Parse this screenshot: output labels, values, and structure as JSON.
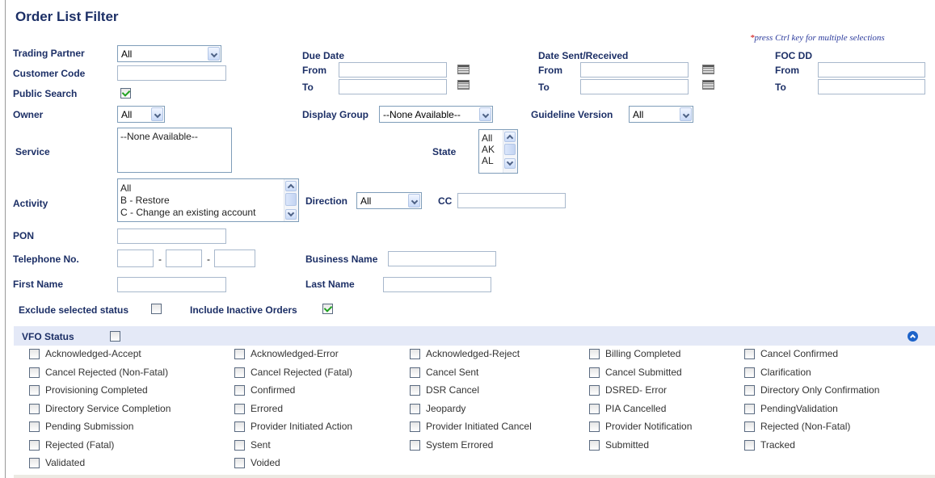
{
  "title": "Order List Filter",
  "note": {
    "star": "*",
    "text": "press Ctrl key for multiple selections"
  },
  "trading_partner": {
    "label": "Trading Partner",
    "value": "All"
  },
  "customer_code": {
    "label": "Customer Code",
    "value": ""
  },
  "public_search": {
    "label": "Public Search",
    "checked": true
  },
  "owner": {
    "label": "Owner",
    "value": "All"
  },
  "due_date": {
    "label": "Due Date",
    "from_label": "From",
    "to_label": "To",
    "from": "",
    "to": ""
  },
  "date_sent": {
    "label": "Date Sent/Received",
    "from_label": "From",
    "to_label": "To",
    "from": "",
    "to": ""
  },
  "foc_dd": {
    "label": "FOC DD",
    "from_label": "From",
    "to_label": "To",
    "from": "",
    "to": ""
  },
  "display_group": {
    "label": "Display Group",
    "value": "--None Available--"
  },
  "guideline_version": {
    "label": "Guideline Version",
    "value": "All"
  },
  "service": {
    "label": "Service",
    "options": [
      "--None Available--"
    ]
  },
  "state": {
    "label": "State",
    "options": [
      "All",
      "AK",
      "AL"
    ]
  },
  "activity": {
    "label": "Activity",
    "options": [
      "All",
      "B - Restore",
      "C - Change an existing account"
    ]
  },
  "direction": {
    "label": "Direction",
    "value": "All"
  },
  "cc": {
    "label": "CC",
    "value": ""
  },
  "pon": {
    "label": "PON",
    "value": ""
  },
  "telephone": {
    "label": "Telephone No.",
    "separator": "-"
  },
  "business_name": {
    "label": "Business Name",
    "value": ""
  },
  "first_name": {
    "label": "First Name",
    "value": ""
  },
  "last_name": {
    "label": "Last Name",
    "value": ""
  },
  "exclude_selected_status": {
    "label": "Exclude selected status",
    "checked": false
  },
  "include_inactive_orders": {
    "label": "Include Inactive Orders",
    "checked": true
  },
  "vfo_status": {
    "label": "VFO Status",
    "checked": false,
    "items": [
      "Acknowledged-Accept",
      "Acknowledged-Error",
      "Acknowledged-Reject",
      "Billing Completed",
      "Cancel Confirmed",
      "Cancel Rejected (Non-Fatal)",
      "Cancel Rejected (Fatal)",
      "Cancel Sent",
      "Cancel Submitted",
      "Clarification",
      "Provisioning Completed",
      "Confirmed",
      "DSR Cancel",
      "DSRED- Error",
      "Directory Only Confirmation",
      "Directory Service Completion",
      "Errored",
      "Jeopardy",
      "PIA Cancelled",
      "PendingValidation",
      "Pending Submission",
      "Provider Initiated Action",
      "Provider Initiated Cancel",
      "Provider Notification",
      "Rejected (Non-Fatal)",
      "Rejected (Fatal)",
      "Sent",
      "System Errored",
      "Submitted",
      "Tracked",
      "Validated",
      "Voided"
    ]
  },
  "colors": {
    "label": "#1c2f66",
    "status_bar": "#e4e9f7",
    "check": "#21a121",
    "note": "#2b3a9c"
  }
}
